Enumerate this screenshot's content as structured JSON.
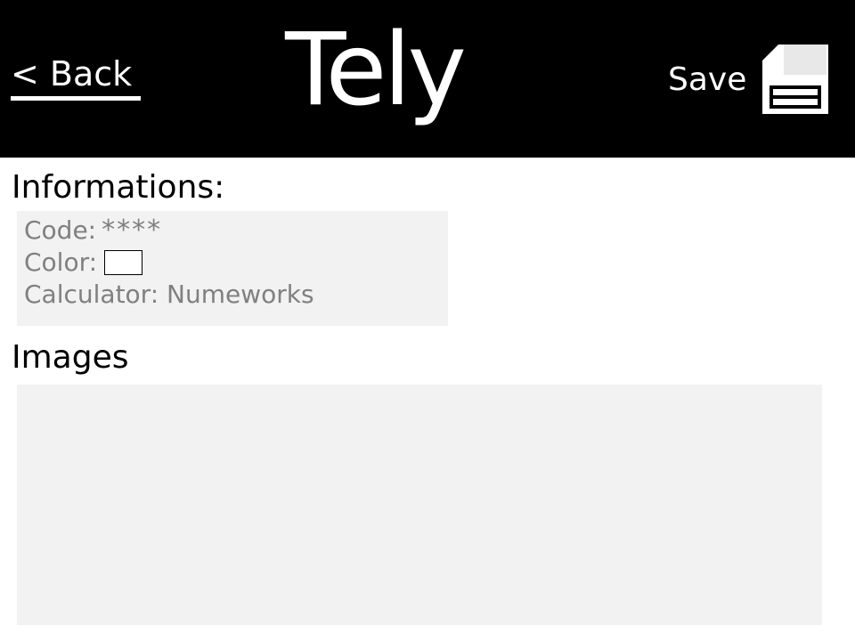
{
  "header": {
    "back_label": "< Back",
    "title": "Tely",
    "save_label": "Save",
    "save_icon": "floppy-disk-icon",
    "background": "#000000",
    "text_color": "#ffffff"
  },
  "informations": {
    "heading": "Informations:",
    "code_label": "Code:",
    "code_value": "****",
    "color_label": "Color:",
    "color_value": "#ffffff",
    "calculator_text": "Calculator: Numeworks"
  },
  "images": {
    "heading": "Images"
  }
}
